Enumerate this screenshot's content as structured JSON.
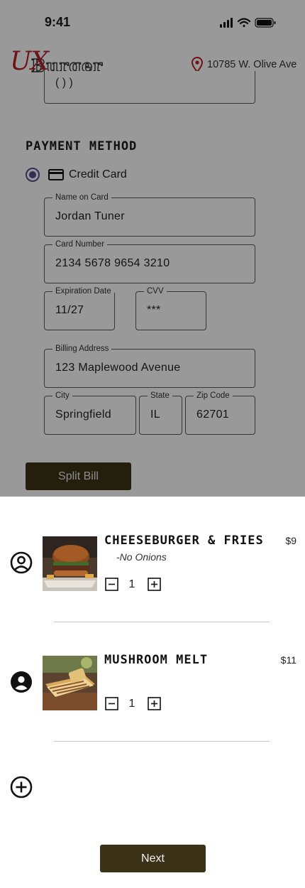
{
  "status_bar": {
    "time": "9:41"
  },
  "header": {
    "logo_ux": "UX",
    "logo_burger": "Burger",
    "location": "10785 W. Olive Ave"
  },
  "partial_field": {
    "value": "( ) )"
  },
  "payment": {
    "section_title": "PAYMENT METHOD",
    "method_label": "Credit Card",
    "fields": {
      "name_on_card": {
        "label": "Name on Card",
        "value": "Jordan Tuner"
      },
      "card_number": {
        "label": "Card Number",
        "value": "2134 5678 9654 3210"
      },
      "expiration": {
        "label": "Expiration Date",
        "value": "11/27"
      },
      "cvv": {
        "label": "CVV",
        "value": "***"
      },
      "billing_address": {
        "label": "Billing Address",
        "value": "123 Maplewood Avenue"
      },
      "city": {
        "label": "City",
        "value": "Springfield"
      },
      "state": {
        "label": "State",
        "value": "IL"
      },
      "zip": {
        "label": "Zip Code",
        "value": "62701"
      }
    },
    "split_bill_label": "Split Bill"
  },
  "order": {
    "items": [
      {
        "name": "CHEESEBURGER & FRIES",
        "note": "-No Onions",
        "price": "$9",
        "quantity": "1",
        "person_icon": "person-outline-icon"
      },
      {
        "name": "MUSHROOM MELT",
        "note": "",
        "price": "$11",
        "quantity": "1",
        "person_icon": "person-filled-icon"
      }
    ],
    "next_label": "Next"
  },
  "colors": {
    "brand_red": "#b41e28",
    "button_dark": "#3c3217",
    "radio_accent": "#5b4a8c"
  }
}
